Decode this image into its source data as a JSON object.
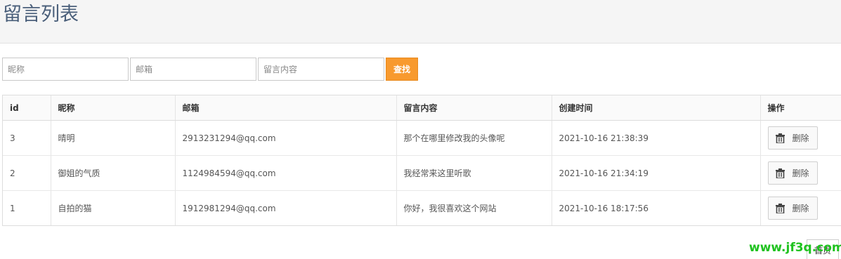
{
  "page_title": "留言列表",
  "search": {
    "nickname_placeholder": "昵称",
    "email_placeholder": "邮箱",
    "content_placeholder": "留言内容",
    "button_label": "查找",
    "button_color": "#f89a2e"
  },
  "table": {
    "headers": [
      "id",
      "昵称",
      "邮箱",
      "留言内容",
      "创建时间",
      "操作"
    ],
    "rows": [
      {
        "id": "3",
        "nickname": "晴明",
        "email": "2913231294@qq.com",
        "content": "那个在哪里修改我的头像呢",
        "created": "2021-10-16 21:38:39",
        "action": "删除"
      },
      {
        "id": "2",
        "nickname": "御姐的气质",
        "email": "1124984594@qq.com",
        "content": "我经常来这里听歌",
        "created": "2021-10-16 21:34:19",
        "action": "删除"
      },
      {
        "id": "1",
        "nickname": "自拍的猫",
        "email": "1912981294@qq.com",
        "content": "你好，我很喜欢这个网站",
        "created": "2021-10-16 18:17:56",
        "action": "删除"
      }
    ]
  },
  "pagination": {
    "first_label": "首页"
  },
  "watermark": "www.jf3q.com"
}
